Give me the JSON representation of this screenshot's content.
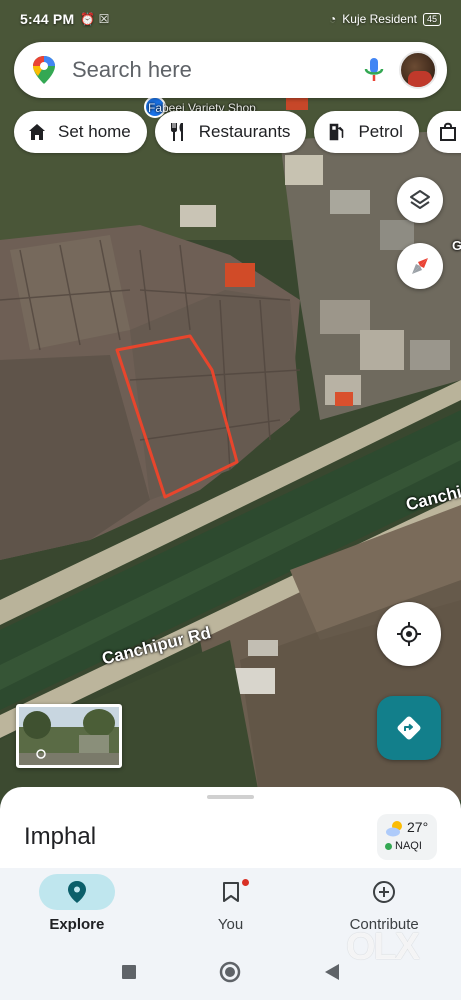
{
  "status_bar": {
    "time": "5:44 PM",
    "carrier": "Kuje Resident",
    "battery": "45"
  },
  "search": {
    "placeholder": "Search here"
  },
  "chips": [
    {
      "label": "Set home",
      "icon": "home-icon"
    },
    {
      "label": "Restaurants",
      "icon": "cutlery-icon"
    },
    {
      "label": "Petrol",
      "icon": "fuel-icon"
    },
    {
      "label": "",
      "icon": "shopping-bag-icon"
    }
  ],
  "map": {
    "poi_label": "Fabeei Variety Shop",
    "road_labels": [
      "Canchipur Rd",
      "Canchi"
    ],
    "edge_letter": "G",
    "colors": {
      "boundary": "#e8452c",
      "road": "#b9b39a",
      "river": "#2d4a2f",
      "field": "#6a5d52"
    }
  },
  "sheet": {
    "place": "Imphal",
    "weather": {
      "temperature": "27°",
      "aqi": "NAQI"
    }
  },
  "nav": [
    {
      "label": "Explore",
      "icon": "explore-pin-icon",
      "active": true
    },
    {
      "label": "You",
      "icon": "bookmark-icon",
      "active": false
    },
    {
      "label": "Contribute",
      "icon": "add-circle-icon",
      "active": false
    }
  ],
  "watermark": "OLX",
  "accent": {
    "directions": "#127f8b",
    "active_pill": "#bfe6ee"
  }
}
